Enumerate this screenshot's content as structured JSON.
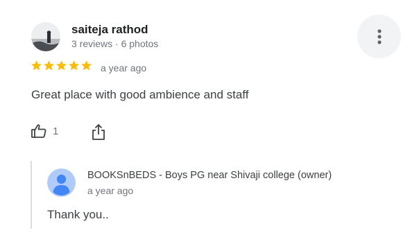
{
  "review": {
    "author": {
      "name": "saiteja rathod",
      "meta": "3 reviews · 6 photos",
      "avatar_icon": "profile-photo-icon"
    },
    "more_options_icon": "more-vert-icon",
    "rating": {
      "value": 5,
      "max": 5,
      "color": "#fbbc04"
    },
    "time": "a year ago",
    "text": "Great place with good ambience and staff",
    "actions": {
      "like_icon": "thumb-up-icon",
      "like_count": "1",
      "share_icon": "share-icon"
    }
  },
  "owner_reply": {
    "avatar_icon": "default-avatar-icon",
    "name": "BOOKSnBEDS - Boys PG near Shivaji college (owner)",
    "time": "a year ago",
    "text": "Thank you..",
    "avatar_color": "#aecbfa"
  }
}
